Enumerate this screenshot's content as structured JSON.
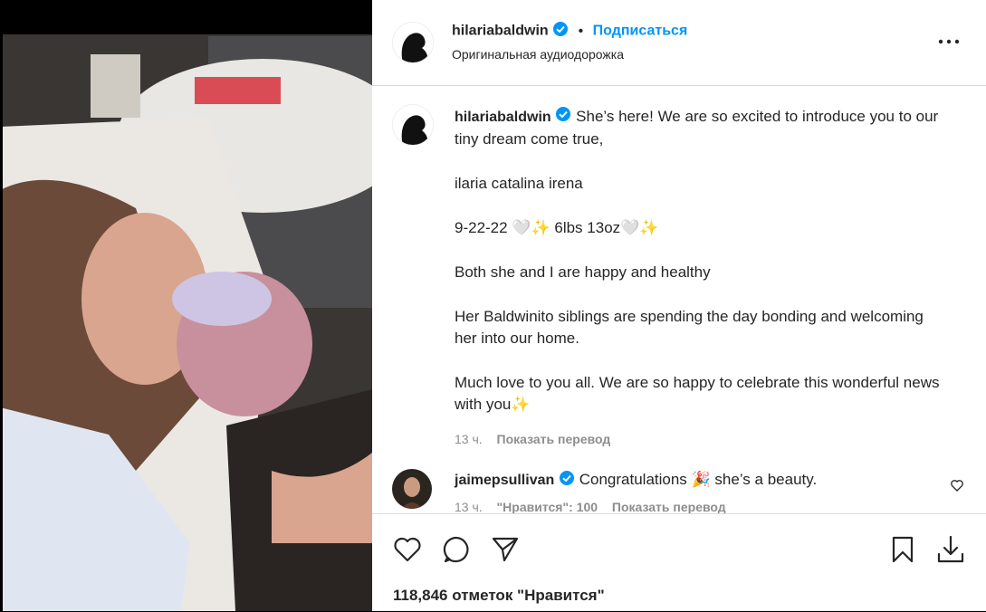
{
  "post": {
    "author": "hilariabaldwin",
    "follow_label": "Подписаться",
    "separator": "•",
    "audio_label": "Оригинальная аудиодорожка",
    "caption_lead": "She’s here! We are so excited to introduce you to our tiny dream come true,",
    "caption_p2": "ilaria catalina irena",
    "caption_p3": "9-22-22 🤍✨ 6lbs 13oz🤍✨",
    "caption_p4": "Both she and I are happy and healthy",
    "caption_p5": "Her Baldwinito siblings are spending the day bonding and welcoming her into our home.",
    "caption_p6": "Much love to you all. We are so happy to celebrate this wonderful news with you✨",
    "time": "13 ч.",
    "translate_label": "Показать перевод"
  },
  "comment": {
    "author": "jaimepsullivan",
    "text": "Congratulations 🎉 she’s a beauty.",
    "time": "13 ч.",
    "likes": "\"Нравится\": 100",
    "translate_label": "Показать перевод"
  },
  "footer": {
    "likes_text": "118,846 отметок \"Нравится\""
  },
  "icons": {
    "verified": "verified-badge-icon",
    "more": "more-options-icon",
    "like": "heart-icon",
    "comment": "comment-bubble-icon",
    "share": "paper-plane-icon",
    "save": "bookmark-icon",
    "download": "download-icon"
  },
  "colors": {
    "accent": "#0095f6",
    "text": "#262626",
    "muted": "#8e8e8e",
    "border": "#dbdbdb"
  }
}
